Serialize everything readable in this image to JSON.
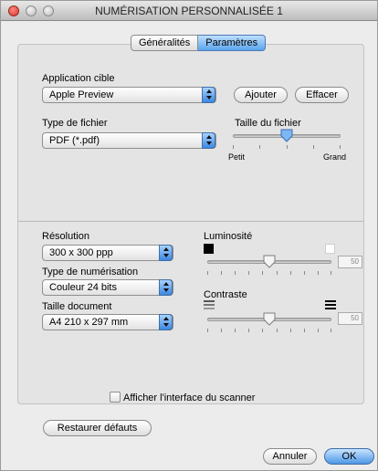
{
  "window": {
    "title": "NUMÉRISATION PERSONNALISÉE 1"
  },
  "tabs": [
    {
      "label": "Généralités",
      "active": false
    },
    {
      "label": "Paramètres",
      "active": true
    }
  ],
  "target_app": {
    "label": "Application cible",
    "value": "Apple Preview",
    "add_label": "Ajouter",
    "delete_label": "Effacer"
  },
  "file_type": {
    "label": "Type de fichier",
    "value": "PDF (*.pdf)"
  },
  "file_size": {
    "label": "Taille du fichier",
    "min_label": "Petit",
    "max_label": "Grand",
    "level_fraction": 0.5
  },
  "resolution": {
    "label": "Résolution",
    "value": "300 x 300 ppp"
  },
  "scan_type": {
    "label": "Type de numérisation",
    "value": "Couleur 24 bits"
  },
  "doc_size": {
    "label": "Taille document",
    "value": "A4  210 x 297 mm"
  },
  "brightness": {
    "label": "Luminosité",
    "value": "50",
    "level_fraction": 0.5
  },
  "contrast": {
    "label": "Contraste",
    "value": "50",
    "level_fraction": 0.5
  },
  "scanner_ui": {
    "label": "Afficher l'interface du scanner",
    "checked": false
  },
  "restore_label": "Restaurer défauts",
  "cancel_label": "Annuler",
  "ok_label": "OK",
  "colors": {
    "accent": "#4d97e6",
    "close": "#d8332a"
  }
}
